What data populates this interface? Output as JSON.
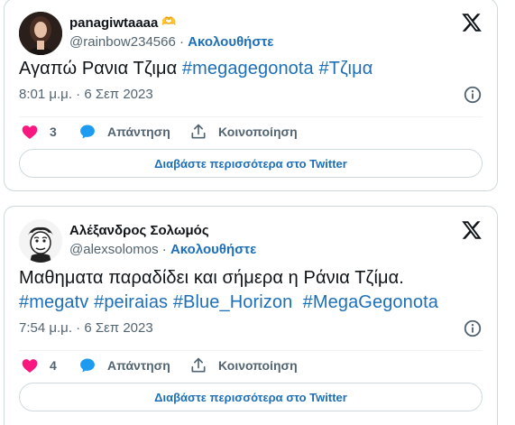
{
  "tweets": [
    {
      "display_name": "panagiwtaaaa",
      "emoji": "🫶",
      "handle": "@rainbow234566",
      "separator": "·",
      "follow_label": "Ακολουθήστε",
      "text_plain": "Αγαπώ Ρανια Τζιμα ",
      "hashtags": [
        "#megagegonota",
        "#Τζιμα"
      ],
      "time": "8:01 μ.μ.",
      "date": "6 Σεπ 2023",
      "like_count": "3",
      "reply_label": "Απάντηση",
      "share_label": "Κοινοποίηση",
      "read_more_label": "Διαβάστε περισσότερα στο Twitter"
    },
    {
      "display_name": "Αλέξανδρος Σολωμός",
      "handle": "@alexsolomos",
      "separator": "·",
      "follow_label": "Ακολουθήστε",
      "text_plain": "Μαθηματα παραδίδει και σήμερα η Ράνια Τζίμα.",
      "hashtags": [
        "#megatv",
        "#peiraias",
        "#Blue_Horizon",
        "#MegaGegonota"
      ],
      "time": "7:54 μ.μ.",
      "date": "6 Σεπ 2023",
      "like_count": "4",
      "reply_label": "Απάντηση",
      "share_label": "Κοινοποίηση",
      "read_more_label": "Διαβάστε περισσότερα στο Twitter"
    }
  ],
  "icons": {
    "logo": "x-logo-icon",
    "info": "info-icon",
    "like": "heart-icon",
    "reply": "speech-bubble-icon",
    "share": "share-upload-icon"
  },
  "colors": {
    "link": "#1d6fb8",
    "like": "#f91880",
    "reply": "#1d9bf0",
    "muted": "#536471",
    "text": "#0f1419",
    "border": "#cfd9de"
  }
}
